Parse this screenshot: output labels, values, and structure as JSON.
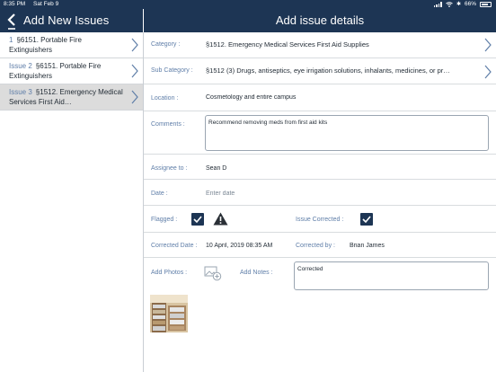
{
  "status_bar": {
    "time": "8:35 PM",
    "date": "Sat Feb 9",
    "battery": "66%"
  },
  "left_header": {
    "title": "Add New Issues"
  },
  "right_header": {
    "title": "Add issue details"
  },
  "issues": [
    {
      "num": "1",
      "text": "§6151. Portable Fire Extinguishers"
    },
    {
      "num": "Issue 2",
      "text": "§6151. Portable Fire Extinguishers"
    },
    {
      "num": "Issue 3",
      "text": "§1512. Emergency Medical Services First Aid…"
    }
  ],
  "form": {
    "category_label": "Category :",
    "category_value": "§1512. Emergency Medical Services First Aid Supplies",
    "subcategory_label": "Sub Category :",
    "subcategory_value": "§1512 (3) Drugs, antiseptics, eye irrigation solutions, inhalants, medicines, or pr…",
    "location_label": "Location :",
    "location_value": "Cosmetology and entire campus",
    "comments_label": "Comments :",
    "comments_value": "Recommend removing meds from first aid kits",
    "assignee_label": "Assignee to :",
    "assignee_value": "Sean D",
    "date_label": "Date :",
    "date_placeholder": "Enter date",
    "flagged_label": "Flagged :",
    "flagged": true,
    "issue_corrected_label": "Issue Corrected :",
    "issue_corrected": true,
    "corrected_date_label": "Corrected Date :",
    "corrected_date_value": "10 April, 2019 08:35 AM",
    "corrected_by_label": "Corrected by :",
    "corrected_by_value": "Brian James",
    "add_photos_label": "Add Photos :",
    "add_notes_label": "Add Notes :",
    "notes_value": "Corrected"
  },
  "colors": {
    "header_bg": "#1d3554",
    "label": "#5f7ea8",
    "accent": "#1d3554",
    "selected_row": "#dcdcdc"
  },
  "icons": [
    "back-chevron-icon",
    "chevron-right-icon",
    "warning-icon",
    "add-photo-icon",
    "battery-icon"
  ]
}
